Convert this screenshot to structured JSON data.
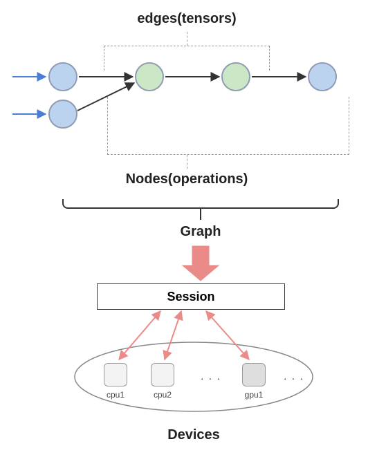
{
  "labels": {
    "edges": "edges(tensors)",
    "nodes": "Nodes(operations)",
    "graph": "Graph",
    "session": "Session",
    "devices": "Devices",
    "ellipsis1": ". . .",
    "ellipsis2": ". . ."
  },
  "node_colors": {
    "input1": "blue",
    "input2": "blue",
    "op1": "green",
    "op2": "green",
    "out": "blue"
  },
  "devices": {
    "cpu1": "cpu1",
    "cpu2": "cpu2",
    "gpu1": "gpu1"
  },
  "chart_data": {
    "type": "diagram",
    "title": "TensorFlow computation graph execution model",
    "components": [
      {
        "name": "Graph",
        "contains": [
          "Nodes(operations)",
          "edges(tensors)"
        ]
      },
      {
        "name": "Session",
        "role": "executes Graph on Devices"
      },
      {
        "name": "Devices",
        "examples": [
          "cpu1",
          "cpu2",
          "gpu1"
        ]
      }
    ],
    "graph_nodes": [
      {
        "id": "input1",
        "kind": "input",
        "color": "blue"
      },
      {
        "id": "input2",
        "kind": "input",
        "color": "blue"
      },
      {
        "id": "op1",
        "kind": "operation",
        "color": "green"
      },
      {
        "id": "op2",
        "kind": "operation",
        "color": "green"
      },
      {
        "id": "out",
        "kind": "output",
        "color": "blue"
      }
    ],
    "graph_edges": [
      {
        "from": "external",
        "to": "input1"
      },
      {
        "from": "external",
        "to": "input2"
      },
      {
        "from": "input1",
        "to": "op1"
      },
      {
        "from": "input2",
        "to": "op1"
      },
      {
        "from": "op1",
        "to": "op2"
      },
      {
        "from": "op2",
        "to": "out"
      }
    ],
    "flow": [
      "Graph",
      "Session",
      "Devices"
    ]
  }
}
